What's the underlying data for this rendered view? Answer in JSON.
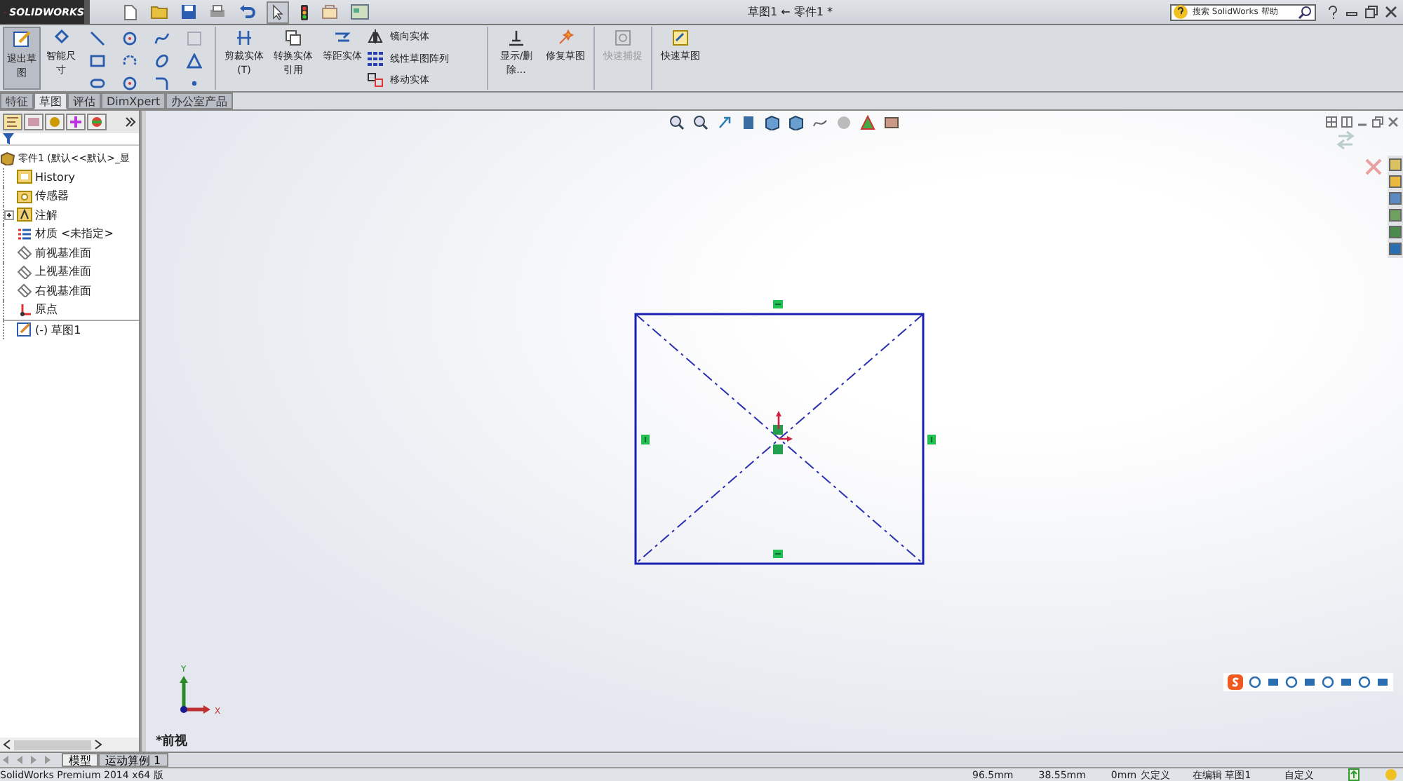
{
  "title_bar": {
    "logo": "SOLIDWORKS",
    "document_title": "草图1 ← 零件1 *",
    "search": {
      "placeholder": "搜索 SolidWorks 帮助"
    }
  },
  "ribbon": {
    "large_tools": [
      {
        "label": "退出草图",
        "selected": true
      },
      {
        "label": "智能尺寸",
        "selected": false
      }
    ],
    "medium_tools": [
      {
        "label": "剪裁实体(T)",
        "kind": "trim"
      },
      {
        "label": "转换实体引用",
        "kind": "convert"
      },
      {
        "label": "等距实体",
        "kind": "offset"
      }
    ],
    "list_tools": [
      {
        "label": "镜向实体",
        "kind": "mirror"
      },
      {
        "label": "线性草图阵列",
        "kind": "pattern"
      },
      {
        "label": "移动实体",
        "kind": "move"
      }
    ],
    "right_tools": [
      {
        "label": "显示/删除...",
        "disabled": false,
        "kind": "relations"
      },
      {
        "label": "修复草图",
        "disabled": false,
        "kind": "repair"
      },
      {
        "label": "快速捕捉",
        "disabled": true,
        "kind": "snap"
      },
      {
        "label": "快速草图",
        "disabled": false,
        "kind": "quick"
      }
    ]
  },
  "tabs": [
    {
      "label": "特征",
      "selected": false
    },
    {
      "label": "草图",
      "selected": true
    },
    {
      "label": "评估",
      "selected": false
    },
    {
      "label": "DimXpert",
      "selected": false
    },
    {
      "label": "办公室产品",
      "selected": false
    }
  ],
  "feature_tree": {
    "root": "零件1 (默认<<默认>_显",
    "items": [
      {
        "label": "History",
        "kind": "history"
      },
      {
        "label": "传感器",
        "kind": "sensor"
      },
      {
        "label": "注解",
        "kind": "annotation",
        "expanded": false
      },
      {
        "label": "材质 <未指定>",
        "kind": "material"
      },
      {
        "label": "前视基准面",
        "kind": "plane"
      },
      {
        "label": "上视基准面",
        "kind": "plane"
      },
      {
        "label": "右视基准面",
        "kind": "plane"
      },
      {
        "label": "原点",
        "kind": "origin"
      },
      {
        "label": "(-) 草图1",
        "kind": "sketch"
      }
    ]
  },
  "viewport": {
    "view_label": "*前视",
    "axis_labels": [
      "Y",
      "X"
    ]
  },
  "bottom_tabs": [
    {
      "label": "模型",
      "selected": true
    },
    {
      "label": "运动算例 1",
      "selected": false
    }
  ],
  "status_bar": {
    "product": "SolidWorks Premium 2014 x64 版",
    "x": "96.5mm",
    "y": "38.55mm",
    "z": "0mm",
    "state": "欠定义",
    "editing": "在编辑 草图1",
    "units": "自定义"
  }
}
